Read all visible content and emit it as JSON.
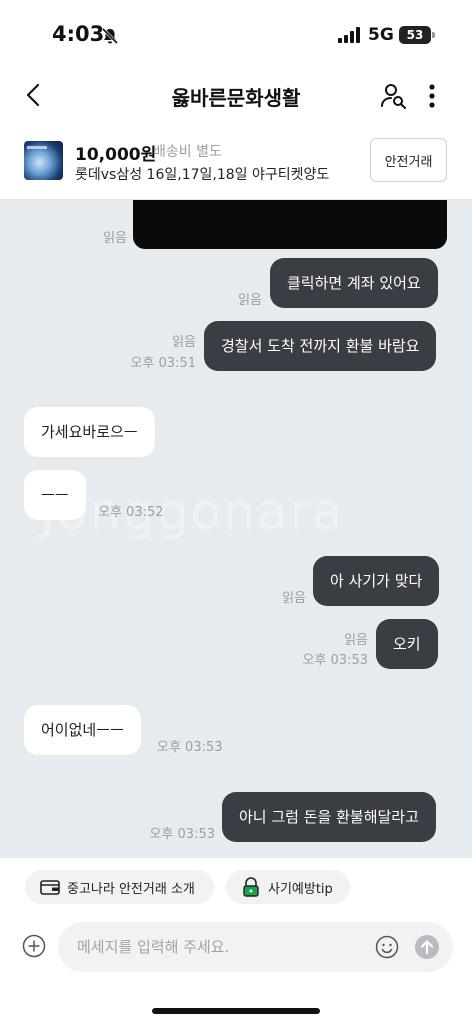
{
  "status": {
    "time": "4:03",
    "network": "5G",
    "battery": "53"
  },
  "header": {
    "title": "옳바른문화생활"
  },
  "product": {
    "price": "10,000원",
    "shipping": "배송비 별도",
    "title": "롯데vs삼성 16일,17일,18일 야구티켓양도",
    "safe_trade_label": "안전거래"
  },
  "watermark": "Jonggonara",
  "messages": [
    {
      "side": "me",
      "text": "",
      "read": "읽음",
      "time": "",
      "censored": true
    },
    {
      "side": "me",
      "text": "클릭하면 계좌 있어요",
      "read": "읽음",
      "time": ""
    },
    {
      "side": "me",
      "text": "경찰서 도착 전까지 환불 바람요",
      "read": "읽음",
      "time": "오후 03:51"
    },
    {
      "side": "other",
      "text": "가세요바로으ㅡ",
      "time": ""
    },
    {
      "side": "other",
      "text": "ㅡㅡ",
      "time": "오후 03:52"
    },
    {
      "side": "me",
      "text": "아 사기가 맞다",
      "read": "읽음",
      "time": ""
    },
    {
      "side": "me",
      "text": "오키",
      "read": "읽음",
      "time": "오후 03:53"
    },
    {
      "side": "other",
      "text": "어이없네ㅡㅡ",
      "time": "오후 03:53"
    },
    {
      "side": "me",
      "text": "아니 그럼 돈을 환불해달라고",
      "read": "",
      "time": "오후 03:53"
    }
  ],
  "chips": {
    "intro": "중고나라 안전거래 소개",
    "tip": "사기예방tip"
  },
  "composer": {
    "placeholder": "메세지를 입력해 주세요."
  },
  "colors": {
    "my_bubble": "#3a3e44",
    "other_bubble": "#ffffff",
    "chat_bg": "#e6ebf0",
    "safe_icon": "#1aa34a"
  }
}
